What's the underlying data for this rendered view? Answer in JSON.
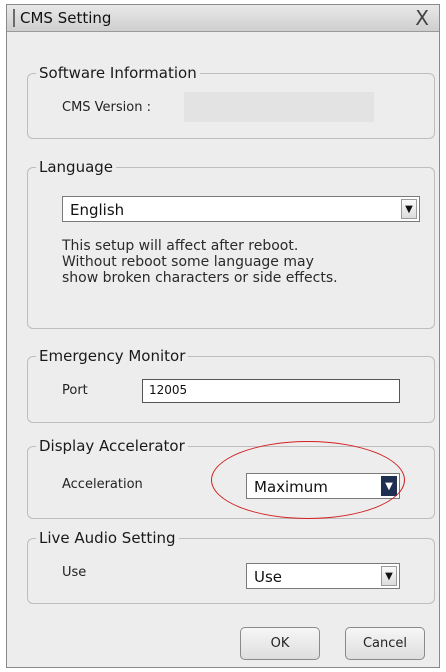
{
  "window": {
    "title": "CMS Setting",
    "close_glyph": "X"
  },
  "software_info": {
    "legend": "Software Information",
    "version_label": "CMS Version :",
    "version_value": ""
  },
  "language": {
    "legend": "Language",
    "selected": "English",
    "note_lines": [
      "This setup will affect after reboot.",
      "Without reboot some language may",
      "show broken characters or side effects."
    ]
  },
  "emergency_monitor": {
    "legend": "Emergency Monitor",
    "port_label": "Port",
    "port_value": "12005"
  },
  "display_accelerator": {
    "legend": "Display Accelerator",
    "acceleration_label": "Acceleration",
    "selected": "Maximum"
  },
  "live_audio": {
    "legend": "Live Audio Setting",
    "use_label": "Use",
    "selected": "Use"
  },
  "buttons": {
    "ok": "OK",
    "cancel": "Cancel"
  },
  "icons": {
    "dropdown_arrow": "▼",
    "close": "close-icon"
  },
  "colors": {
    "highlight": "#d32020",
    "selected_arrow": "#1f2f52"
  }
}
